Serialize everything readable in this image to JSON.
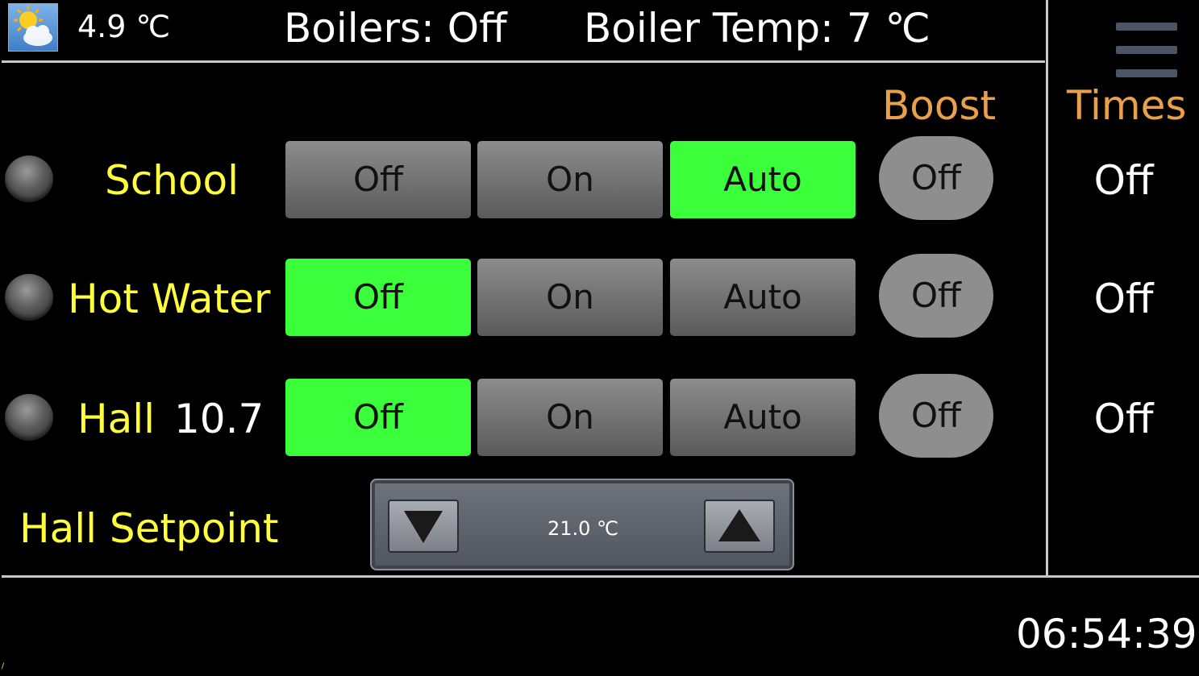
{
  "header": {
    "weather_icon": "sun-cloud-icon",
    "outside_temp": "4.9 ℃",
    "boilers_status": "Boilers: Off",
    "boiler_temp": "Boiler Temp: 7 ℃",
    "menu_icon": "hamburger-menu-icon"
  },
  "columns": {
    "boost": "Boost",
    "times": "Times"
  },
  "zones": [
    {
      "label": "School",
      "temp": "",
      "modes": [
        "Off",
        "On",
        "Auto"
      ],
      "active_mode": "Auto",
      "boost": "Off",
      "times": "Off"
    },
    {
      "label": "Hot Water",
      "temp": "",
      "modes": [
        "Off",
        "On",
        "Auto"
      ],
      "active_mode": "Off",
      "boost": "Off",
      "times": "Off"
    },
    {
      "label": "Hall",
      "temp": "10.7",
      "modes": [
        "Off",
        "On",
        "Auto"
      ],
      "active_mode": "Off",
      "boost": "Off",
      "times": "Off"
    }
  ],
  "setpoint": {
    "label": "Hall Setpoint",
    "value": "21.0 ℃"
  },
  "clock": "06:54:39",
  "colors": {
    "active": "#3cff3c",
    "inactive": "#8c8c8c",
    "zone_label": "#ffff3c",
    "column_header": "#e8a04a"
  }
}
